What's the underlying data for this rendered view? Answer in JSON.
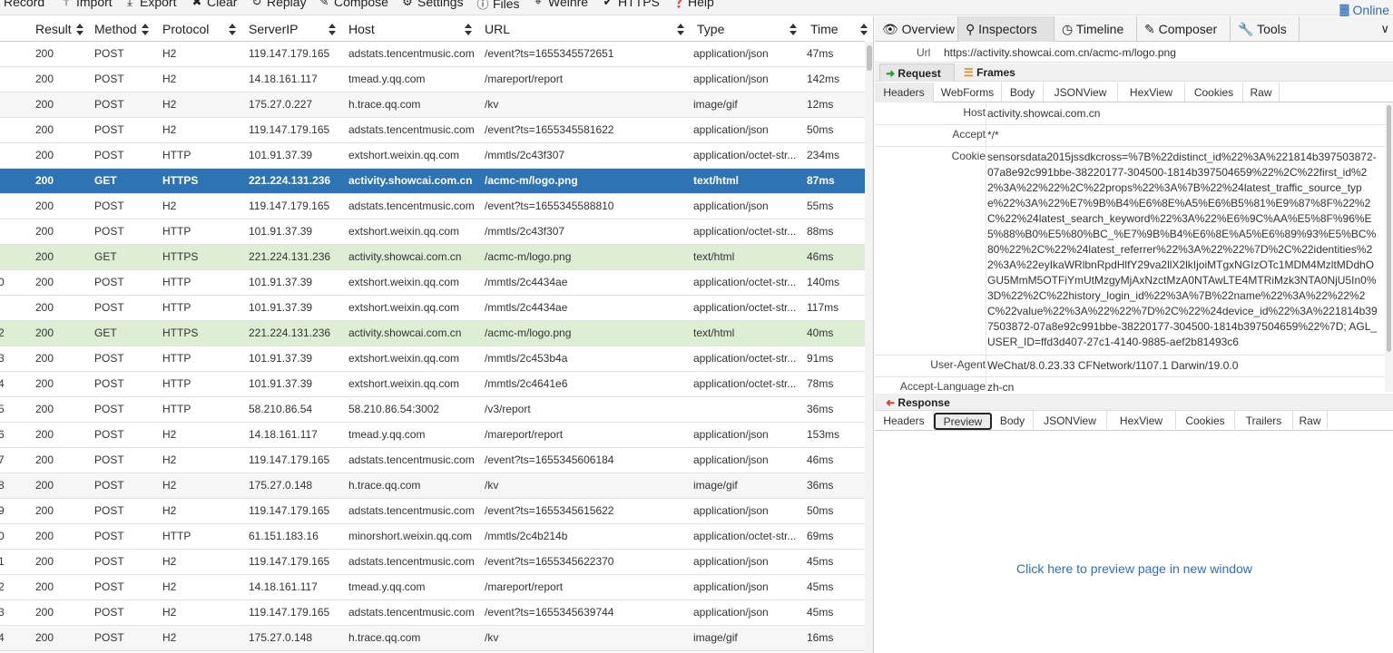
{
  "toolbar": {
    "items": [
      {
        "label": "Record",
        "icon": "record-icon",
        "glyph": ""
      },
      {
        "label": "Import",
        "icon": "import-icon",
        "glyph": "⤒"
      },
      {
        "label": "Export",
        "icon": "export-icon",
        "glyph": "⤓"
      },
      {
        "label": "Clear",
        "icon": "clear-icon",
        "glyph": "✖"
      },
      {
        "label": "Replay",
        "icon": "replay-icon",
        "glyph": "↻"
      },
      {
        "label": "Compose",
        "icon": "compose-icon",
        "glyph": "✎"
      },
      {
        "label": "Settings",
        "icon": "settings-icon",
        "glyph": "⚙"
      },
      {
        "label": "Files",
        "icon": "files-icon",
        "glyph": "ⓘ"
      },
      {
        "label": "Weinre",
        "icon": "weinre-icon",
        "glyph": "⌖"
      },
      {
        "label": "HTTPS",
        "icon": "https-icon",
        "glyph": "✔"
      },
      {
        "label": "Help",
        "icon": "help-icon",
        "glyph": "❓"
      }
    ],
    "online": "Online"
  },
  "grid": {
    "columns": [
      "Result",
      "Method",
      "Protocol",
      "ServerIP",
      "Host",
      "URL",
      "Type",
      "Time"
    ],
    "rows": [
      {
        "num": "",
        "result": "200",
        "method": "POST",
        "protocol": "H2",
        "ip": "119.147.179.165",
        "host": "adstats.tencentmusic.com",
        "url": "/event?ts=1655345572651",
        "type": "application/json",
        "time": "47ms",
        "style": ""
      },
      {
        "num": "",
        "result": "200",
        "method": "POST",
        "protocol": "H2",
        "ip": "14.18.161.117",
        "host": "tmead.y.qq.com",
        "url": "/mareport/report",
        "type": "application/json",
        "time": "142ms",
        "style": ""
      },
      {
        "num": "",
        "result": "200",
        "method": "POST",
        "protocol": "H2",
        "ip": "175.27.0.227",
        "host": "h.trace.qq.com",
        "url": "/kv",
        "type": "image/gif",
        "time": "12ms",
        "style": "alt"
      },
      {
        "num": "",
        "result": "200",
        "method": "POST",
        "protocol": "H2",
        "ip": "119.147.179.165",
        "host": "adstats.tencentmusic.com",
        "url": "/event?ts=1655345581622",
        "type": "application/json",
        "time": "50ms",
        "style": ""
      },
      {
        "num": "",
        "result": "200",
        "method": "POST",
        "protocol": "HTTP",
        "ip": "101.91.37.39",
        "host": "extshort.weixin.qq.com",
        "url": "/mmtls/2c43f307",
        "type": "application/octet-str...",
        "time": "234ms",
        "style": ""
      },
      {
        "num": "",
        "result": "200",
        "method": "GET",
        "protocol": "HTTPS",
        "ip": "221.224.131.236",
        "host": "activity.showcai.com.cn",
        "url": "/acmc-m/logo.png",
        "type": "text/html",
        "time": "87ms",
        "style": "sel"
      },
      {
        "num": "",
        "result": "200",
        "method": "POST",
        "protocol": "H2",
        "ip": "119.147.179.165",
        "host": "adstats.tencentmusic.com",
        "url": "/event?ts=1655345588810",
        "type": "application/json",
        "time": "55ms",
        "style": ""
      },
      {
        "num": "",
        "result": "200",
        "method": "POST",
        "protocol": "HTTP",
        "ip": "101.91.37.39",
        "host": "extshort.weixin.qq.com",
        "url": "/mmtls/2c43f307",
        "type": "application/octet-str...",
        "time": "88ms",
        "style": ""
      },
      {
        "num": "",
        "result": "200",
        "method": "GET",
        "protocol": "HTTPS",
        "ip": "221.224.131.236",
        "host": "activity.showcai.com.cn",
        "url": "/acmc-m/logo.png",
        "type": "text/html",
        "time": "46ms",
        "style": "grn"
      },
      {
        "num": "0",
        "result": "200",
        "method": "POST",
        "protocol": "HTTP",
        "ip": "101.91.37.39",
        "host": "extshort.weixin.qq.com",
        "url": "/mmtls/2c4434ae",
        "type": "application/octet-str...",
        "time": "140ms",
        "style": ""
      },
      {
        "num": "",
        "result": "200",
        "method": "POST",
        "protocol": "HTTP",
        "ip": "101.91.37.39",
        "host": "extshort.weixin.qq.com",
        "url": "/mmtls/2c4434ae",
        "type": "application/octet-str...",
        "time": "117ms",
        "style": ""
      },
      {
        "num": "2",
        "result": "200",
        "method": "GET",
        "protocol": "HTTPS",
        "ip": "221.224.131.236",
        "host": "activity.showcai.com.cn",
        "url": "/acmc-m/logo.png",
        "type": "text/html",
        "time": "40ms",
        "style": "grn"
      },
      {
        "num": "3",
        "result": "200",
        "method": "POST",
        "protocol": "HTTP",
        "ip": "101.91.37.39",
        "host": "extshort.weixin.qq.com",
        "url": "/mmtls/2c453b4a",
        "type": "application/octet-str...",
        "time": "91ms",
        "style": ""
      },
      {
        "num": "4",
        "result": "200",
        "method": "POST",
        "protocol": "HTTP",
        "ip": "101.91.37.39",
        "host": "extshort.weixin.qq.com",
        "url": "/mmtls/2c4641e6",
        "type": "application/octet-str...",
        "time": "78ms",
        "style": ""
      },
      {
        "num": "5",
        "result": "200",
        "method": "POST",
        "protocol": "HTTP",
        "ip": "58.210.86.54",
        "host": "58.210.86.54:3002",
        "url": "/v3/report",
        "type": "",
        "time": "36ms",
        "style": ""
      },
      {
        "num": "6",
        "result": "200",
        "method": "POST",
        "protocol": "H2",
        "ip": "14.18.161.117",
        "host": "tmead.y.qq.com",
        "url": "/mareport/report",
        "type": "application/json",
        "time": "153ms",
        "style": ""
      },
      {
        "num": "7",
        "result": "200",
        "method": "POST",
        "protocol": "H2",
        "ip": "119.147.179.165",
        "host": "adstats.tencentmusic.com",
        "url": "/event?ts=1655345606184",
        "type": "application/json",
        "time": "46ms",
        "style": ""
      },
      {
        "num": "8",
        "result": "200",
        "method": "POST",
        "protocol": "H2",
        "ip": "175.27.0.148",
        "host": "h.trace.qq.com",
        "url": "/kv",
        "type": "image/gif",
        "time": "36ms",
        "style": "alt"
      },
      {
        "num": "9",
        "result": "200",
        "method": "POST",
        "protocol": "H2",
        "ip": "119.147.179.165",
        "host": "adstats.tencentmusic.com",
        "url": "/event?ts=1655345615622",
        "type": "application/json",
        "time": "50ms",
        "style": ""
      },
      {
        "num": "0",
        "result": "200",
        "method": "POST",
        "protocol": "HTTP",
        "ip": "61.151.183.16",
        "host": "minorshort.weixin.qq.com",
        "url": "/mmtls/2c4b214b",
        "type": "application/octet-str...",
        "time": "69ms",
        "style": ""
      },
      {
        "num": "1",
        "result": "200",
        "method": "POST",
        "protocol": "H2",
        "ip": "119.147.179.165",
        "host": "adstats.tencentmusic.com",
        "url": "/event?ts=1655345622370",
        "type": "application/json",
        "time": "45ms",
        "style": ""
      },
      {
        "num": "2",
        "result": "200",
        "method": "POST",
        "protocol": "H2",
        "ip": "14.18.161.117",
        "host": "tmead.y.qq.com",
        "url": "/mareport/report",
        "type": "application/json",
        "time": "45ms",
        "style": ""
      },
      {
        "num": "3",
        "result": "200",
        "method": "POST",
        "protocol": "H2",
        "ip": "119.147.179.165",
        "host": "adstats.tencentmusic.com",
        "url": "/event?ts=1655345639744",
        "type": "application/json",
        "time": "45ms",
        "style": ""
      },
      {
        "num": "4",
        "result": "200",
        "method": "POST",
        "protocol": "H2",
        "ip": "175.27.0.148",
        "host": "h.trace.qq.com",
        "url": "/kv",
        "type": "image/gif",
        "time": "16ms",
        "style": "alt"
      }
    ]
  },
  "tabs": {
    "overview": "Overview",
    "inspectors": "Inspectors",
    "timeline": "Timeline",
    "composer": "Composer",
    "tools": "Tools"
  },
  "url": {
    "label": "Url",
    "value": "https://activity.showcai.com.cn/acmc-m/logo.png"
  },
  "request": {
    "label": "Request",
    "frames": "Frames",
    "subtabs": [
      "Headers",
      "WebForms",
      "Body",
      "JSONView",
      "HexView",
      "Cookies",
      "Raw"
    ],
    "headers": [
      {
        "key": "Host",
        "value": "activity.showcai.com.cn"
      },
      {
        "key": "Accept",
        "value": "*/*"
      },
      {
        "key": "Cookie",
        "value": "sensorsdata2015jssdkcross=%7B%22distinct_id%22%3A%221814b397503872-07a8e92c991bbe-38220177-304500-1814b397504659%22%2C%22first_id%22%3A%22%22%2C%22props%22%3A%7B%22%24latest_traffic_source_type%22%3A%22%E7%9B%B4%E6%8E%A5%E6%B5%81%E9%87%8F%22%2C%22%24latest_search_keyword%22%3A%22%E6%9C%AA%E5%8F%96%E5%88%B0%E5%80%BC_%E7%9B%B4%E6%8E%A5%E6%89%93%E5%BC%80%22%2C%22%24latest_referrer%22%3A%22%22%7D%2C%22identities%22%3A%22eyIkaWRlbnRpdHlfY29va2llX2lkIjoiMTgxNGIzOTc1MDM4MzltMDdhOGU5MmM5OTFiYmUtMzgyMjAxNzctMzA0NTAwLTE4MTRiMzk3NTA0NjU5In0%3D%22%2C%22history_login_id%22%3A%7B%22name%22%3A%22%22%2C%22value%22%3A%22%22%7D%2C%22%24device_id%22%3A%221814b397503872-07a8e92c991bbe-38220177-304500-1814b397504659%22%7D; AGL_USER_ID=ffd3d407-27c1-4140-9885-aef2b81493c6"
      },
      {
        "key": "User-Agent",
        "value": "WeChat/8.0.23.33 CFNetwork/1107.1 Darwin/19.0.0"
      },
      {
        "key": "Accept-Language",
        "value": "zh-cn"
      }
    ]
  },
  "response": {
    "label": "Response",
    "subtabs": [
      "Headers",
      "Preview",
      "Body",
      "JSONView",
      "HexView",
      "Cookies",
      "Trailers",
      "Raw"
    ],
    "preview_link": "Click here to preview page in new window"
  },
  "colors": {
    "selected_row": "#2e74b5",
    "green_row": "#dcefd4",
    "link": "#2f6fb5"
  }
}
